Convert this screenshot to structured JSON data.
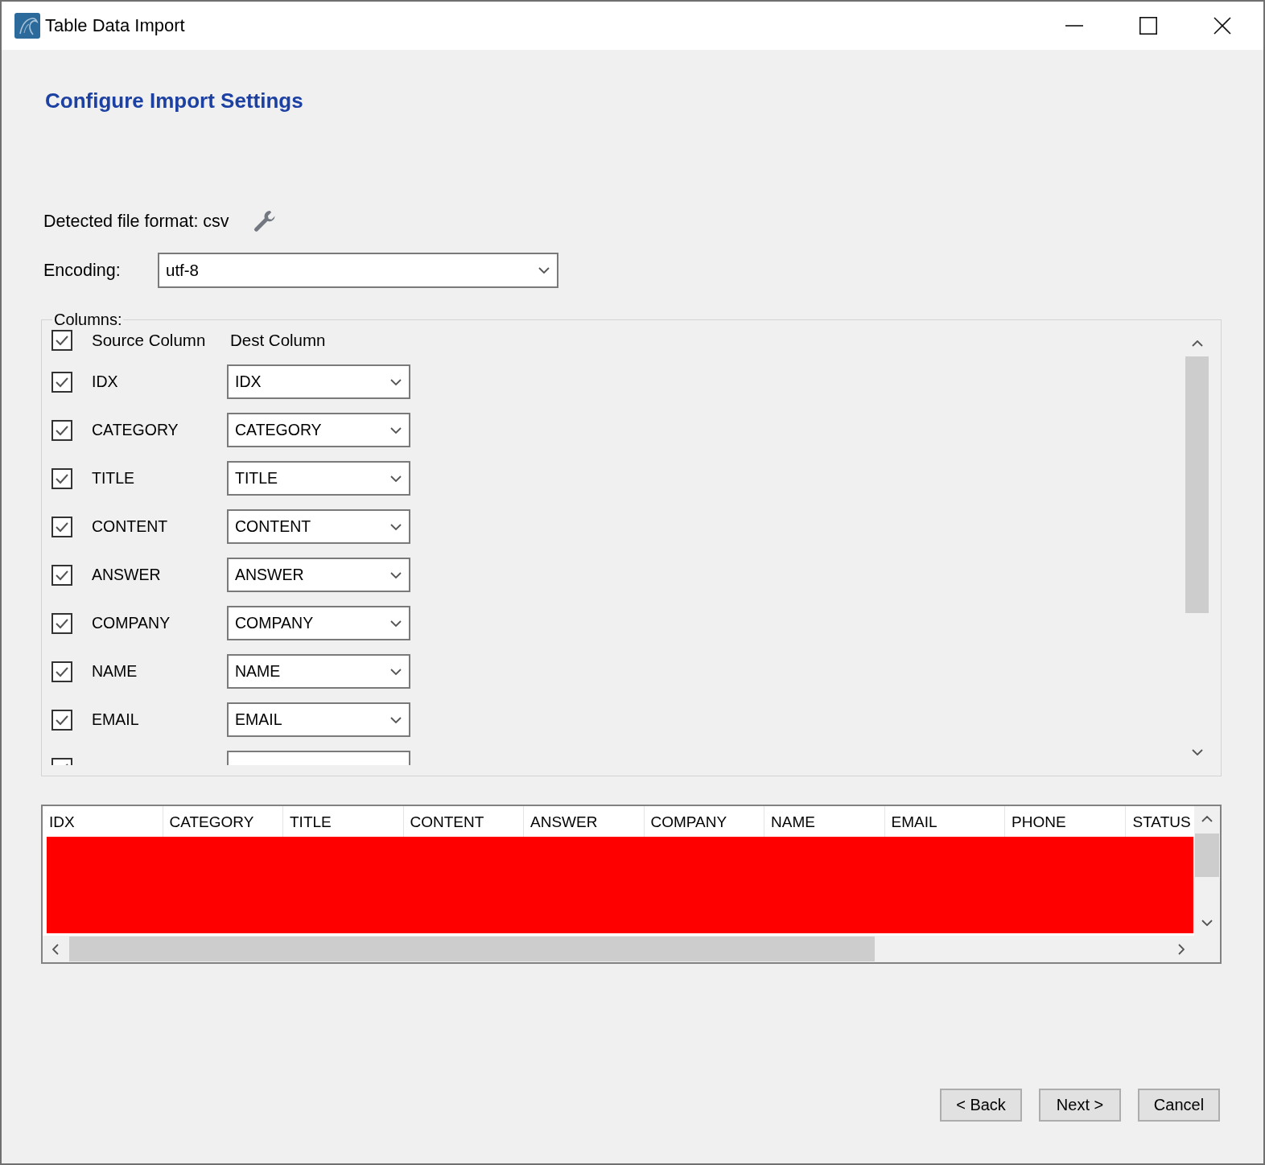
{
  "window": {
    "title": "Table Data Import"
  },
  "heading": "Configure Import Settings",
  "file_format": {
    "label": "Detected file format: csv"
  },
  "encoding": {
    "label": "Encoding:",
    "value": "utf-8"
  },
  "columns": {
    "legend": "Columns:",
    "header": {
      "checked": true,
      "source": "Source Column",
      "dest": "Dest Column"
    },
    "rows": [
      {
        "checked": true,
        "source": "IDX",
        "dest": "IDX"
      },
      {
        "checked": true,
        "source": "CATEGORY",
        "dest": "CATEGORY"
      },
      {
        "checked": true,
        "source": "TITLE",
        "dest": "TITLE"
      },
      {
        "checked": true,
        "source": "CONTENT",
        "dest": "CONTENT"
      },
      {
        "checked": true,
        "source": "ANSWER",
        "dest": "ANSWER"
      },
      {
        "checked": true,
        "source": "COMPANY",
        "dest": "COMPANY"
      },
      {
        "checked": true,
        "source": "NAME",
        "dest": "NAME"
      },
      {
        "checked": true,
        "source": "EMAIL",
        "dest": "EMAIL"
      },
      {
        "checked": true
      }
    ]
  },
  "preview": {
    "columns": [
      "IDX",
      "CATEGORY",
      "TITLE",
      "CONTENT",
      "ANSWER",
      "COMPANY",
      "NAME",
      "EMAIL",
      "PHONE",
      "STATUS"
    ],
    "redacted": true
  },
  "buttons": [
    "< Back",
    "Next >",
    "Cancel"
  ]
}
